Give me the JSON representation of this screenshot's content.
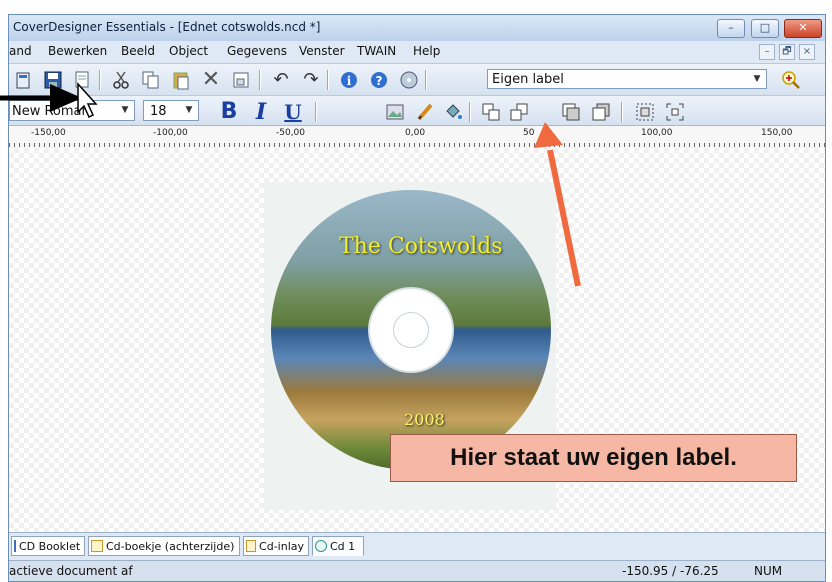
{
  "window": {
    "title": "CoverDesigner Essentials - [Ednet cotswolds.ncd *]",
    "controls": {
      "minimize": "–",
      "maximize": "□",
      "close": "✕"
    }
  },
  "menu": {
    "items": [
      "and",
      "Bewerken",
      "Beeld",
      "Object",
      "Gegevens",
      "Venster",
      "TWAIN",
      "Help"
    ],
    "mdi_controls": [
      "–",
      "🗗",
      "×"
    ]
  },
  "toolbar": {
    "label_select": {
      "value": "Eigen label"
    },
    "font_select": {
      "value": "New Roman"
    },
    "size_select": {
      "value": "18"
    },
    "bold": "B",
    "italic": "I",
    "underline": "U"
  },
  "ruler": {
    "labels": [
      "-150,00",
      "-100,00",
      "-50,00",
      "0,00",
      "50",
      "100,00",
      "150,00"
    ]
  },
  "disc": {
    "title": "The Cotswolds",
    "year": "2008"
  },
  "callout": {
    "text": "Hier staat uw eigen label."
  },
  "tabs": [
    {
      "label": "CD Booklet"
    },
    {
      "label": "Cd-boekje (achterzijde)"
    },
    {
      "label": "Cd-inlay"
    },
    {
      "label": "Cd 1"
    }
  ],
  "statusbar": {
    "message": "actieve document af",
    "coordinates": "-150.95 / -76.25",
    "num": "NUM"
  },
  "colors": {
    "callout_bg": "#f6b8a4",
    "arrow": "#f06a40",
    "disc_title": "#f3ef2a"
  }
}
